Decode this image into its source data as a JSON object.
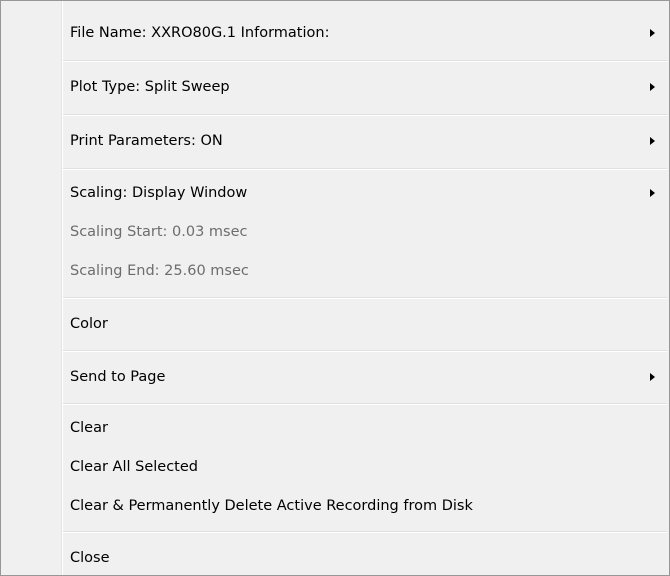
{
  "menu": {
    "items": [
      {
        "label": "File Name: XXRO80G.1  Information:",
        "has_submenu": true,
        "enabled": true
      },
      {
        "label": "Plot Type: Split Sweep",
        "has_submenu": true,
        "enabled": true
      },
      {
        "label": "Print Parameters: ON",
        "has_submenu": true,
        "enabled": true
      },
      {
        "label": "Scaling: Display Window",
        "has_submenu": true,
        "enabled": true
      },
      {
        "label": "Scaling Start:  0.03 msec",
        "has_submenu": false,
        "enabled": false
      },
      {
        "label": "Scaling End: 25.60 msec",
        "has_submenu": false,
        "enabled": false
      },
      {
        "label": "Color",
        "has_submenu": false,
        "enabled": true
      },
      {
        "label": "Send to Page",
        "has_submenu": true,
        "enabled": true
      },
      {
        "label": "Clear",
        "has_submenu": false,
        "enabled": true
      },
      {
        "label": "Clear All Selected",
        "has_submenu": false,
        "enabled": true
      },
      {
        "label": "Clear & Permanently Delete Active Recording from Disk",
        "has_submenu": false,
        "enabled": true
      },
      {
        "label": "Close",
        "has_submenu": false,
        "enabled": true
      }
    ]
  },
  "colors": {
    "menu_background": "#f0f0f0",
    "disabled_text": "#6d6d6d",
    "separator": "#e0e0e0",
    "border": "#979797"
  }
}
